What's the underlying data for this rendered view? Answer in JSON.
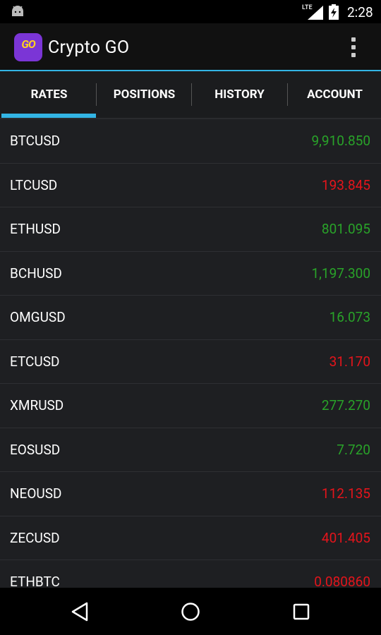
{
  "status_bar": {
    "time": "2:28",
    "network": "LTE",
    "icons": [
      "android-icon",
      "lte-icon",
      "signal-icon",
      "battery-charging-icon"
    ]
  },
  "app": {
    "title": "Crypto GO",
    "logo_text": "GO",
    "accent_color": "#33b5e5"
  },
  "tabs": [
    {
      "label": "RATES",
      "selected": true
    },
    {
      "label": "POSITIONS",
      "selected": false
    },
    {
      "label": "HISTORY",
      "selected": false
    },
    {
      "label": "ACCOUNT",
      "selected": false
    }
  ],
  "rates": [
    {
      "symbol": "BTCUSD",
      "value": "9,910.850",
      "trend": "up"
    },
    {
      "symbol": "LTCUSD",
      "value": "193.845",
      "trend": "down"
    },
    {
      "symbol": "ETHUSD",
      "value": "801.095",
      "trend": "up"
    },
    {
      "symbol": "BCHUSD",
      "value": "1,197.300",
      "trend": "up"
    },
    {
      "symbol": "OMGUSD",
      "value": "16.073",
      "trend": "up"
    },
    {
      "symbol": "ETCUSD",
      "value": "31.170",
      "trend": "down"
    },
    {
      "symbol": "XMRUSD",
      "value": "277.270",
      "trend": "up"
    },
    {
      "symbol": "EOSUSD",
      "value": "7.720",
      "trend": "up"
    },
    {
      "symbol": "NEOUSD",
      "value": "112.135",
      "trend": "down"
    },
    {
      "symbol": "ZECUSD",
      "value": "401.405",
      "trend": "down"
    },
    {
      "symbol": "ETHBTC",
      "value": "0.080860",
      "trend": "down"
    }
  ],
  "colors": {
    "up": "#29a329",
    "down": "#e4141b"
  },
  "nav": [
    "back-icon",
    "home-icon",
    "recents-icon"
  ]
}
